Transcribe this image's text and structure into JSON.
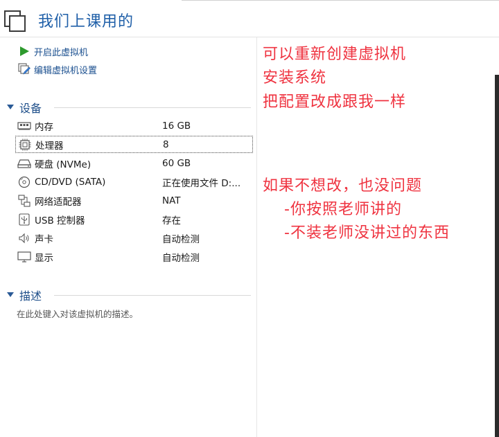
{
  "header": {
    "title": "我们上课用的"
  },
  "actions": [
    {
      "label": "开启此虚拟机",
      "icon": "play-icon"
    },
    {
      "label": "编辑虚拟机设置",
      "icon": "edit-settings-icon"
    }
  ],
  "devices_section": {
    "title": "设备",
    "items": [
      {
        "name": "内存",
        "value": "16 GB",
        "icon": "memory-icon"
      },
      {
        "name": "处理器",
        "value": "8",
        "icon": "processor-icon",
        "selected": true
      },
      {
        "name": "硬盘 (NVMe)",
        "value": "60 GB",
        "icon": "hard-disk-icon"
      },
      {
        "name": "CD/DVD (SATA)",
        "value": "正在使用文件 D:...",
        "icon": "cd-dvd-icon"
      },
      {
        "name": "网络适配器",
        "value": "NAT",
        "icon": "network-adapter-icon"
      },
      {
        "name": "USB 控制器",
        "value": "存在",
        "icon": "usb-icon"
      },
      {
        "name": "声卡",
        "value": "自动检测",
        "icon": "speaker-icon"
      },
      {
        "name": "显示",
        "value": "自动检测",
        "icon": "monitor-icon"
      }
    ]
  },
  "description_section": {
    "title": "描述",
    "placeholder": "在此处键入对该虚拟机的描述。"
  },
  "annotations": [
    "可以重新创建虚拟机",
    "安装系统",
    "把配置改成跟我一样",
    "如果不想改，也没问题",
    "-你按照老师讲的",
    "-不装老师没讲过的东西"
  ],
  "colors": {
    "title": "#1f5fa8",
    "annotation": "#ef3340",
    "play": "#2e9a2e"
  }
}
